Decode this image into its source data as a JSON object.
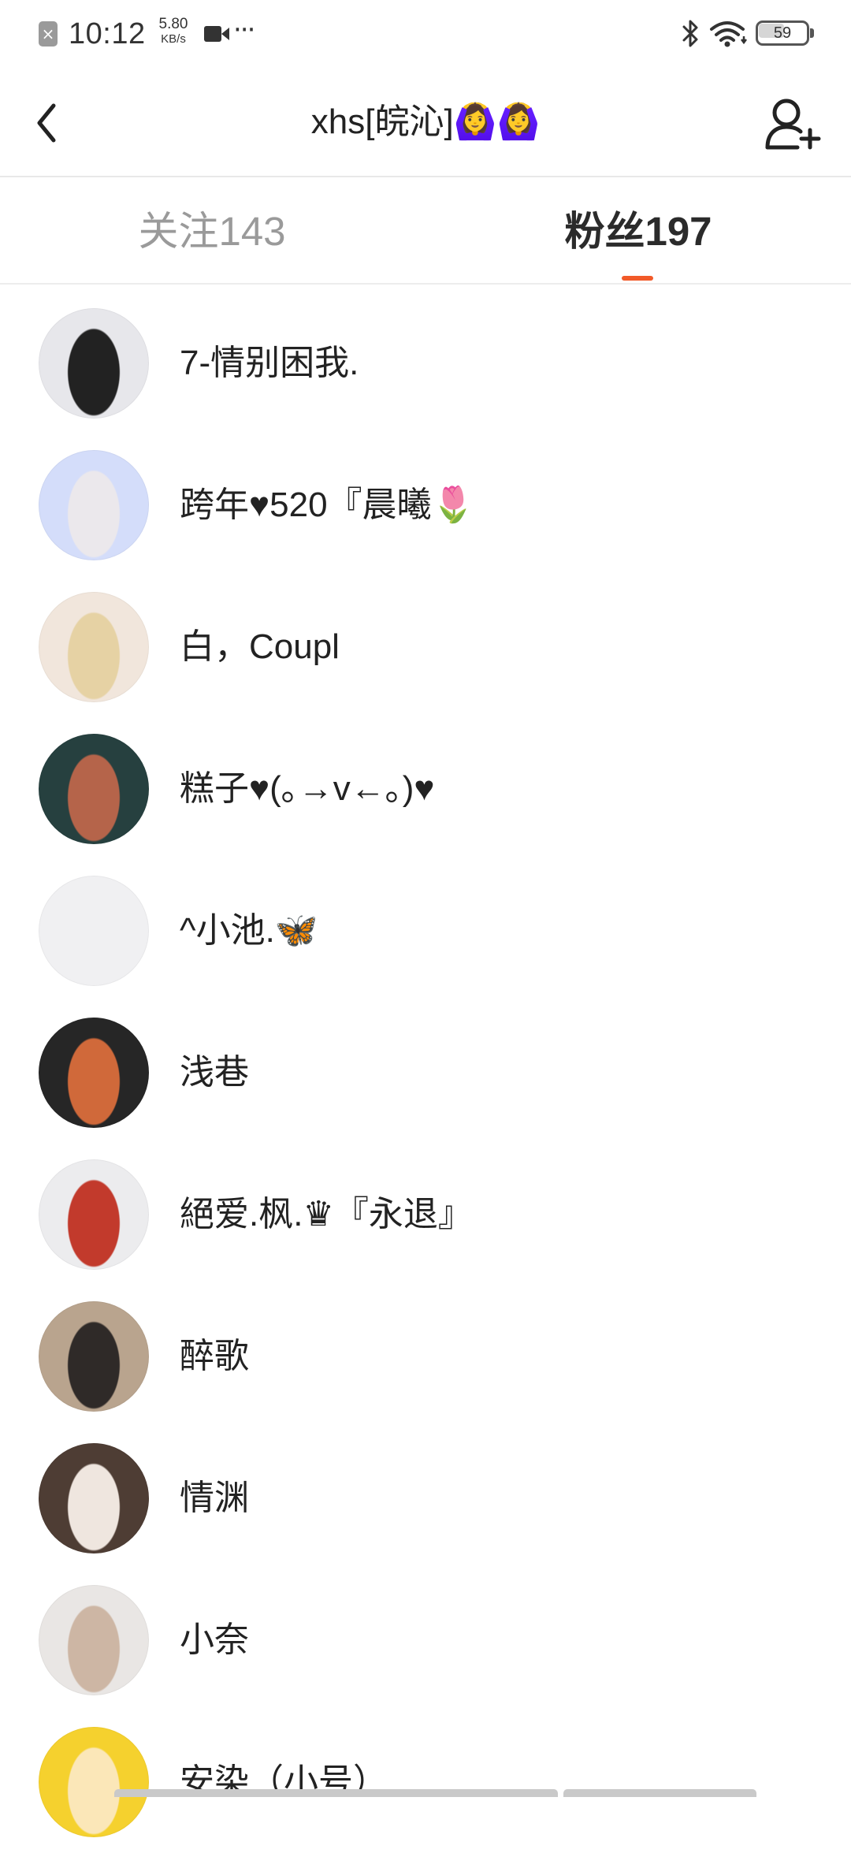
{
  "status_bar": {
    "time": "10:12",
    "net_speed_value": "5.80",
    "net_speed_unit": "KB/s",
    "more": "···",
    "battery": "59",
    "battery_level": 0.59,
    "icons": [
      "notification-icon",
      "video-camera-icon",
      "bluetooth-icon",
      "wifi-icon",
      "battery-icon"
    ]
  },
  "header": {
    "title": "xhs[皖沁]🙆‍♀️🙆‍♀️",
    "back_icon": "chevron-left-icon",
    "add_user_icon": "add-user-icon"
  },
  "tabs": [
    {
      "label": "关注143",
      "active": false
    },
    {
      "label": "粉丝197",
      "active": true
    }
  ],
  "accent_color": "#f25a29",
  "followers": [
    {
      "name": "7-情别困我.",
      "avatar_colors": [
        "#e7e7eb",
        "#222222"
      ]
    },
    {
      "name": "跨年♥520『晨曦🌷",
      "avatar_colors": [
        "#d4ddfa",
        "#ebe8ec"
      ]
    },
    {
      "name": "白，Coupl",
      "avatar_colors": [
        "#f1e6dc",
        "#e6d2a4"
      ]
    },
    {
      "name": "糕子♥(｡→v←｡)♥",
      "avatar_colors": [
        "#26403f",
        "#b5644a"
      ]
    },
    {
      "name": "^小池.🦋",
      "avatar_colors": [
        "#f0f0f2",
        "#f0f0f2"
      ]
    },
    {
      "name": "浅巷",
      "avatar_colors": [
        "#262626",
        "#d0693a"
      ]
    },
    {
      "name": "絕爱.枫.♛『永退』",
      "avatar_colors": [
        "#ececee",
        "#c23a2c"
      ]
    },
    {
      "name": "醉歌",
      "avatar_colors": [
        "#b9a48e",
        "#2f2a28"
      ]
    },
    {
      "name": "情渊",
      "avatar_colors": [
        "#4e3d34",
        "#efe6df"
      ]
    },
    {
      "name": "小奈",
      "avatar_colors": [
        "#e9e6e4",
        "#cdb6a4"
      ]
    },
    {
      "name": "安染（小号）",
      "avatar_colors": [
        "#f5d12e",
        "#fbe7b8"
      ]
    }
  ]
}
